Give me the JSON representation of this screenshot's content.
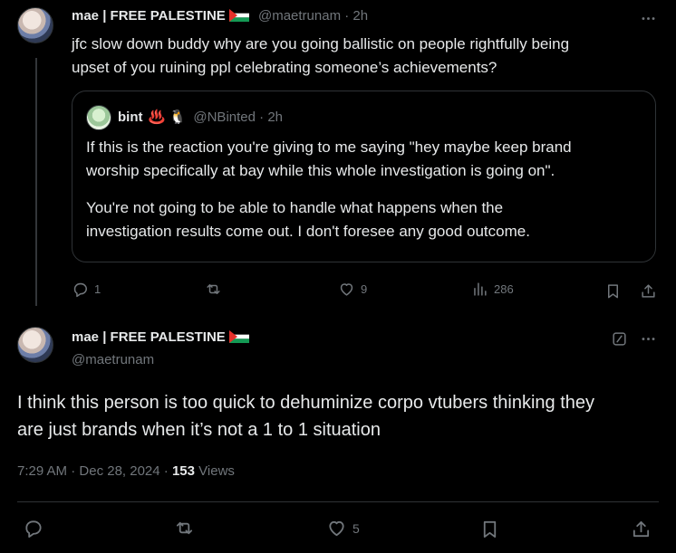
{
  "reply_tweet": {
    "display_name": "mae | FREE PALESTINE",
    "handle": "@maetrunam",
    "separator": "·",
    "time_ago": "2h",
    "text_line1": "jfc slow down buddy why are you going ballistic on people rightfully being",
    "text_line2": "upset of you ruining ppl celebrating someone’s achievements?",
    "quote": {
      "display_name": "bint",
      "emojis": "♨️ 🐧",
      "handle": "@NBinted",
      "separator": "·",
      "time_ago": "2h",
      "para1_line1": "If this is the reaction you're giving to me saying \"hey maybe keep brand",
      "para1_line2": "worship specifically at bay while this whole investigation is going on\".",
      "para2_line1": "You're not going to be able to handle what happens when the",
      "para2_line2": "investigation results come out. I don't foresee any good outcome."
    },
    "replies": "1",
    "reposts": "",
    "likes": "9",
    "views": "286"
  },
  "main_tweet": {
    "display_name": "mae | FREE PALESTINE",
    "handle": "@maetrunam",
    "text_line1": "I think this person is too quick to dehuminize corpo vtubers thinking they",
    "text_line2": "are just brands when it’s not a 1 to 1 situation",
    "time": "7:29 AM",
    "separator": "·",
    "date": "Dec 28, 2024",
    "separator2": "·",
    "views_count": "153",
    "views_label": "Views",
    "replies": "",
    "reposts": "",
    "likes": "5"
  },
  "colors": {
    "background": "#000000",
    "text": "#e7e9ea",
    "muted": "#71767b",
    "border": "#2f3336"
  },
  "icons": [
    "more-icon",
    "reply-icon",
    "repost-icon",
    "like-icon",
    "views-icon",
    "bookmark-icon",
    "share-icon",
    "grok-icon",
    "flag-palestine-icon"
  ]
}
